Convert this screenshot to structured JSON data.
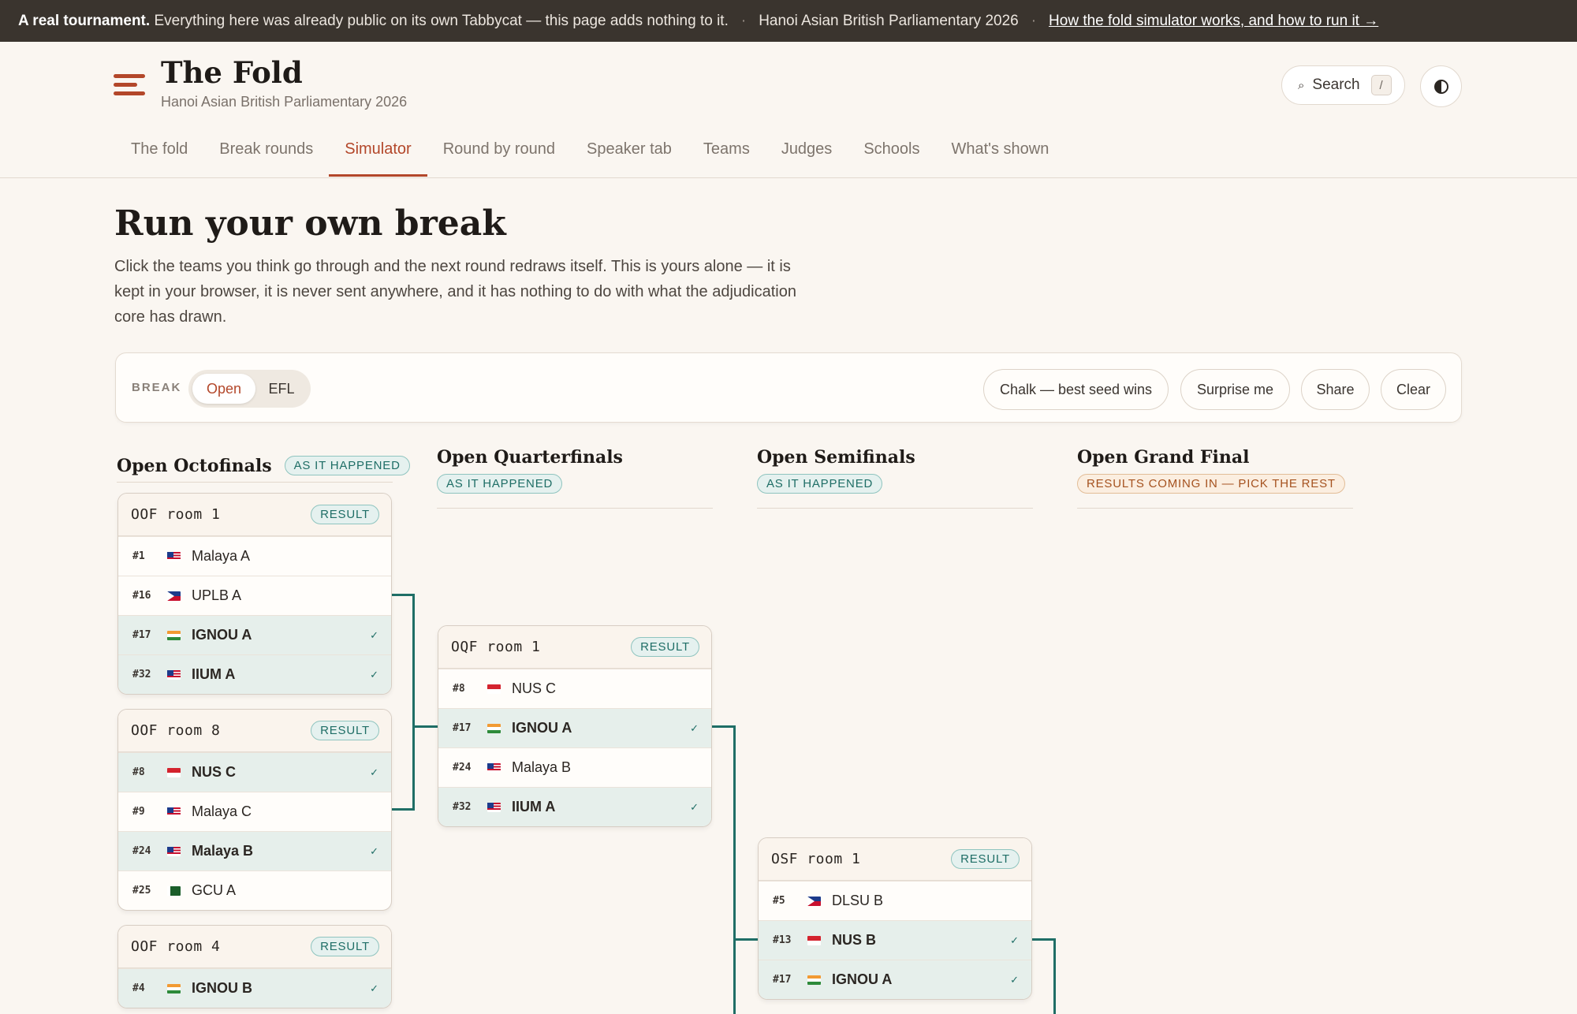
{
  "banner": {
    "bold": "A real tournament.",
    "text": "Everything here was already public on its own Tabbycat — this page adds nothing to it.",
    "sep1": "·",
    "tournament": "Hanoi Asian British Parliamentary 2026",
    "sep2": "·",
    "link": "How the fold simulator works, and how to run it →"
  },
  "header": {
    "title": "The Fold",
    "subtitle": "Hanoi Asian British Parliamentary 2026",
    "search_label": "Search",
    "search_key": "/"
  },
  "nav": {
    "items": [
      "The fold",
      "Break rounds",
      "Simulator",
      "Round by round",
      "Speaker tab",
      "Teams",
      "Judges",
      "Schools",
      "What's shown"
    ],
    "active": "Simulator"
  },
  "hero": {
    "title": "Run your own break",
    "description": "Click the teams you think go through and the next round redraws itself. This is yours alone — it is kept in your browser, it is never sent anywhere, and it has nothing to do with what the adjudication core has drawn."
  },
  "controls": {
    "break_label": "BREAK",
    "options": [
      "Open",
      "EFL"
    ],
    "selected": "Open",
    "buttons": [
      "Chalk — best seed wins",
      "Surprise me",
      "Share",
      "Clear"
    ]
  },
  "bracket": {
    "columns": [
      {
        "title": "Open Octofinals",
        "badge": "AS IT HAPPENED"
      },
      {
        "title": "Open Quarterfinals",
        "badge": "AS IT HAPPENED"
      },
      {
        "title": "Open Semifinals",
        "badge": "AS IT HAPPENED"
      },
      {
        "title": "Open Grand Final",
        "badge": "RESULTS COMING IN — PICK THE REST"
      }
    ],
    "rooms": [
      {
        "name": "OOF room 1",
        "badge": "RESULT",
        "teams": [
          {
            "seed": "#1",
            "name": "Malaya A",
            "flag": "my",
            "advanced": false
          },
          {
            "seed": "#16",
            "name": "UPLB A",
            "flag": "ph",
            "advanced": false
          },
          {
            "seed": "#17",
            "name": "IGNOU A",
            "flag": "in",
            "advanced": true
          },
          {
            "seed": "#32",
            "name": "IIUM A",
            "flag": "my",
            "advanced": true
          }
        ]
      },
      {
        "name": "OOF room 8",
        "badge": "RESULT",
        "teams": [
          {
            "seed": "#8",
            "name": "NUS C",
            "flag": "sg",
            "advanced": true
          },
          {
            "seed": "#9",
            "name": "Malaya C",
            "flag": "my",
            "advanced": false
          },
          {
            "seed": "#24",
            "name": "Malaya B",
            "flag": "my",
            "advanced": true
          },
          {
            "seed": "#25",
            "name": "GCU A",
            "flag": "pk",
            "advanced": false
          }
        ]
      },
      {
        "name": "OOF room 4",
        "badge": "RESULT",
        "teams": [
          {
            "seed": "#4",
            "name": "IGNOU B",
            "flag": "in",
            "advanced": true
          }
        ]
      },
      {
        "name": "OQF room 1",
        "badge": "RESULT",
        "teams": [
          {
            "seed": "#8",
            "name": "NUS C",
            "flag": "sg",
            "advanced": false
          },
          {
            "seed": "#17",
            "name": "IGNOU A",
            "flag": "in",
            "advanced": true
          },
          {
            "seed": "#24",
            "name": "Malaya B",
            "flag": "my",
            "advanced": false
          },
          {
            "seed": "#32",
            "name": "IIUM A",
            "flag": "my",
            "advanced": true
          }
        ]
      },
      {
        "name": "OSF room 1",
        "badge": "RESULT",
        "teams": [
          {
            "seed": "#5",
            "name": "DLSU B",
            "flag": "ph",
            "advanced": false
          },
          {
            "seed": "#13",
            "name": "NUS B",
            "flag": "sg",
            "advanced": true
          },
          {
            "seed": "#17",
            "name": "IGNOU A",
            "flag": "in",
            "advanced": true
          }
        ]
      }
    ],
    "check_mark": "✓"
  },
  "colors": {
    "accent": "#b3472a",
    "advance": "#1f6e66",
    "banner_bg": "#3a342e",
    "page_bg": "#faf6f1"
  }
}
